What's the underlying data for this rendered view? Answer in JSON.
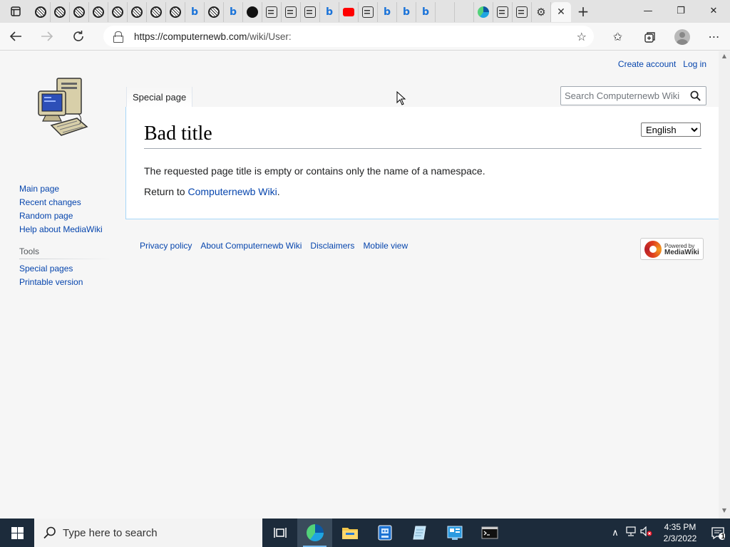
{
  "browser": {
    "url_host": "https://computernewb.com",
    "url_path": "/wiki/User:",
    "tab_close": "✕",
    "new_tab": "+",
    "window": {
      "minimize": "—",
      "restore": "❐",
      "close": "✕"
    }
  },
  "wiki": {
    "site_name": "Computernewb Wiki",
    "personal": {
      "create_account": "Create account",
      "log_in": "Log in"
    },
    "namespace_tab": "Special page",
    "search_placeholder": "Search Computernewb Wiki",
    "heading": "Bad title",
    "language": {
      "selected": "English",
      "options": [
        "English"
      ]
    },
    "body": {
      "message": "The requested page title is empty or contains only the name of a namespace.",
      "return_prefix": "Return to ",
      "return_link": "Computernewb Wiki",
      "return_suffix": "."
    },
    "navigation": [
      "Main page",
      "Recent changes",
      "Random page",
      "Help about MediaWiki"
    ],
    "tools_heading": "Tools",
    "tools": [
      "Special pages",
      "Printable version"
    ],
    "footer": [
      "Privacy policy",
      "About Computernewb Wiki",
      "Disclaimers",
      "Mobile view"
    ],
    "powered_by": {
      "line1": "Powered by",
      "line2": "MediaWiki"
    }
  },
  "taskbar": {
    "search_placeholder": "Type here to search",
    "time": "4:35 PM",
    "date": "2/3/2022",
    "notification_count": "1"
  },
  "colors": {
    "link": "#0645ad",
    "accent_border": "#a7d7f9",
    "taskbar": "#1c2b3b"
  }
}
